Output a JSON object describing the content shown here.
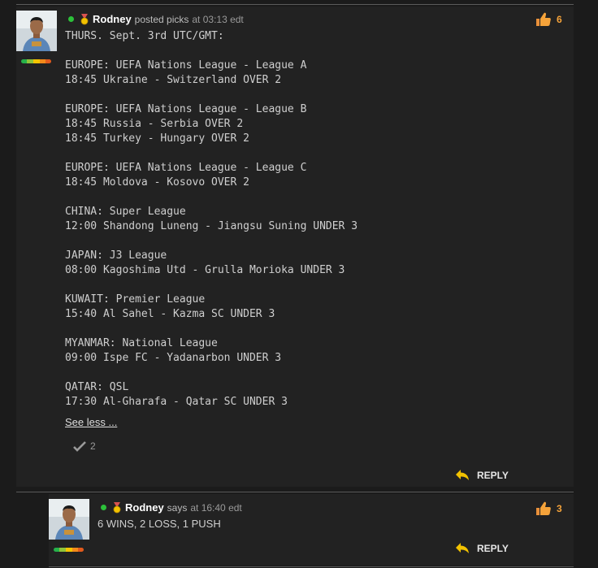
{
  "post": {
    "username": "Rodney",
    "action": "posted picks",
    "timestamp": "at 03:13 edt",
    "likes": "6",
    "content": [
      "THURS. Sept. 3rd UTC/GMT:",
      "",
      "EUROPE: UEFA Nations League - League A",
      "18:45 Ukraine - Switzerland OVER 2",
      "",
      "EUROPE: UEFA Nations League - League B",
      "18:45 Russia - Serbia OVER 2",
      "18:45 Turkey - Hungary OVER 2",
      "",
      "EUROPE: UEFA Nations League - League C",
      "18:45 Moldova - Kosovo OVER 2",
      "",
      "CHINA: Super League",
      "12:00 Shandong Luneng - Jiangsu Suning UNDER 3",
      "",
      "JAPAN: J3 League",
      "08:00 Kagoshima Utd - Grulla Morioka UNDER 3",
      "",
      "KUWAIT: Premier League",
      "15:40 Al Sahel - Kazma SC UNDER 3",
      "",
      "MYANMAR: National League",
      "09:00 Ispe FC - Yadanarbon UNDER 3",
      "",
      "QATAR: QSL",
      "17:30 Al-Gharafa - Qatar SC UNDER 3"
    ],
    "see_less": "See less ...",
    "check_count": "2",
    "reply_label": "REPLY"
  },
  "reply_post": {
    "username": "Rodney",
    "action": "says",
    "timestamp": "at 16:40 edt",
    "likes": "3",
    "content": "6 WINS, 2 LOSS, 1 PUSH",
    "reply_label": "REPLY"
  },
  "colors": {
    "online": "#2cc13a",
    "likes": "#f5a33a",
    "reply_arrow": "#f2c200",
    "background": "#1b1b1b",
    "panel": "#222222"
  },
  "reputation_bar": [
    "#27b14a",
    "#8fc43a",
    "#f5c400",
    "#f28a1a",
    "#e25a1c"
  ],
  "icons": [
    "online-status-icon",
    "medal-icon",
    "thumbs-up-icon",
    "checkmark-icon",
    "reply-arrow-icon"
  ]
}
